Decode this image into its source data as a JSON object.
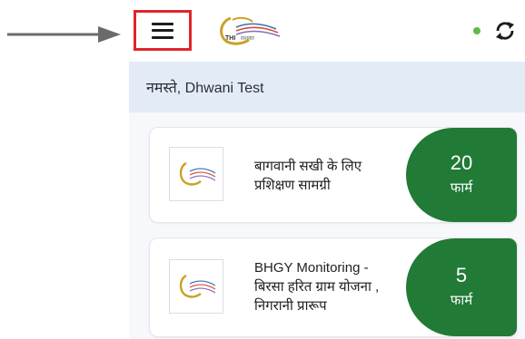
{
  "header": {
    "logo_text": "THI",
    "logo_subtext": "सशक्त",
    "sync_status_color": "#5fbb46"
  },
  "greeting": {
    "text": "नमस्ते, Dhwani Test"
  },
  "forms": [
    {
      "title_line1": "बागवानी सखी के लिए",
      "title_line2": "प्रशिक्षण सामग्री",
      "count": "20",
      "unit": "फार्म"
    },
    {
      "title_line1": "BHGY Monitoring -",
      "title_line2": "बिरसा हरित ग्राम योजना ,",
      "title_line3": "निगरानी प्रारूप",
      "count": "5",
      "unit": "फार्म"
    }
  ],
  "colors": {
    "badge_green": "#217a35",
    "highlight_red": "#e0242a",
    "greeting_bg": "#e3ecf6"
  },
  "icons": {
    "menu": "hamburger-menu-icon",
    "sync": "sync-icon",
    "annotation": "arrow-right-icon"
  }
}
